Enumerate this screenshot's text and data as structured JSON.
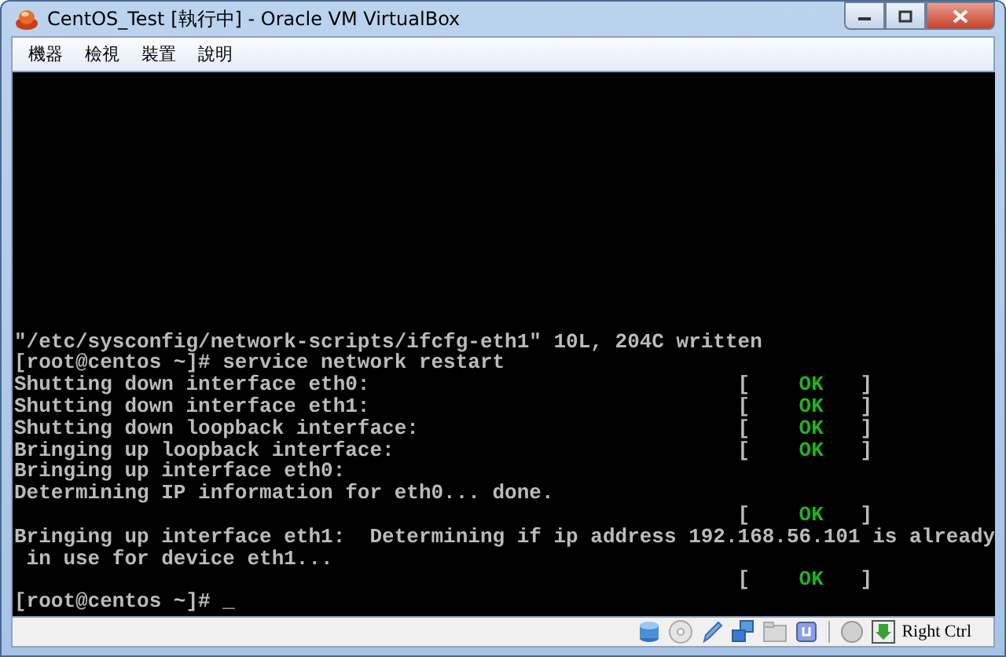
{
  "window": {
    "title": "CentOS_Test [執行中] - Oracle VM VirtualBox"
  },
  "menu": [
    "機器",
    "檢視",
    "裝置",
    "說明"
  ],
  "terminal": {
    "lines": [
      {
        "text": "\"/etc/sysconfig/network-scripts/ifcfg-eth1\" 10L, 204C written"
      },
      {
        "text": "[root@centos ~]# service network restart"
      },
      {
        "text": "Shutting down interface eth0:",
        "status": {
          "left": "[",
          "text": "OK",
          "right": "]"
        }
      },
      {
        "text": "Shutting down interface eth1:",
        "status": {
          "left": "[",
          "text": "OK",
          "right": "]"
        }
      },
      {
        "text": "Shutting down loopback interface:",
        "status": {
          "left": "[",
          "text": "OK",
          "right": "]"
        }
      },
      {
        "text": "Bringing up loopback interface:",
        "status": {
          "left": "[",
          "text": "OK",
          "right": "]"
        }
      },
      {
        "text": "Bringing up interface eth0:"
      },
      {
        "text": "Determining IP information for eth0... done."
      },
      {
        "status": {
          "left": "[",
          "text": "OK",
          "right": "]"
        }
      },
      {
        "text": "Bringing up interface eth1:  Determining if ip address 192.168.56.101 is already"
      },
      {
        "text": " in use for device eth1..."
      },
      {
        "status": {
          "left": "[",
          "text": "OK",
          "right": "]"
        }
      },
      {
        "text": "[root@centos ~]# _"
      }
    ]
  },
  "status_bar": {
    "host_key": "Right Ctrl"
  }
}
